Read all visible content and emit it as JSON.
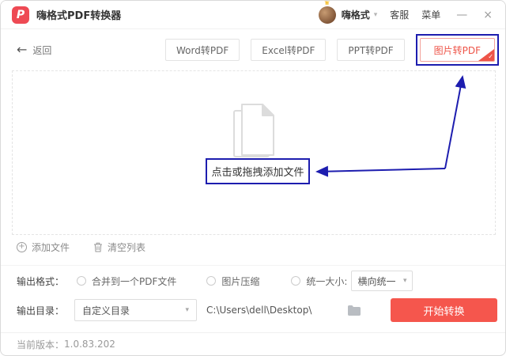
{
  "window": {
    "title": "嗨格式PDF转换器"
  },
  "titlebar": {
    "username": "嗨格式",
    "support": "客服",
    "menu": "菜单"
  },
  "toolbar": {
    "back": "返回",
    "tabs": [
      {
        "label": "Word转PDF"
      },
      {
        "label": "Excel转PDF"
      },
      {
        "label": "PPT转PDF"
      },
      {
        "label": "图片转PDF",
        "active": true
      }
    ]
  },
  "dropzone": {
    "hint": "点击或拖拽添加文件"
  },
  "file_actions": {
    "add": "添加文件",
    "clear": "清空列表"
  },
  "output_format": {
    "label": "输出格式：",
    "merge_option": "合并到一个PDF文件",
    "compress_option": "图片压缩",
    "size_option": "统一大小:",
    "size_value": "横向统一"
  },
  "output_dir": {
    "label": "输出目录：",
    "dir_value": "自定义目录",
    "path": "C:\\Users\\dell\\Desktop\\",
    "start": "开始转换"
  },
  "statusbar": {
    "version_label": "当前版本：",
    "version": "1.0.83.202"
  },
  "icons": {
    "logo": "P",
    "crown": "♛",
    "chevron_down": "▾",
    "minimize": "—",
    "close": "×",
    "back": "←",
    "plus": "+",
    "check": "✓"
  },
  "colors": {
    "accent_red": "#ee4a54",
    "button_red": "#f5564d",
    "annotation_blue": "#1d1daf"
  }
}
